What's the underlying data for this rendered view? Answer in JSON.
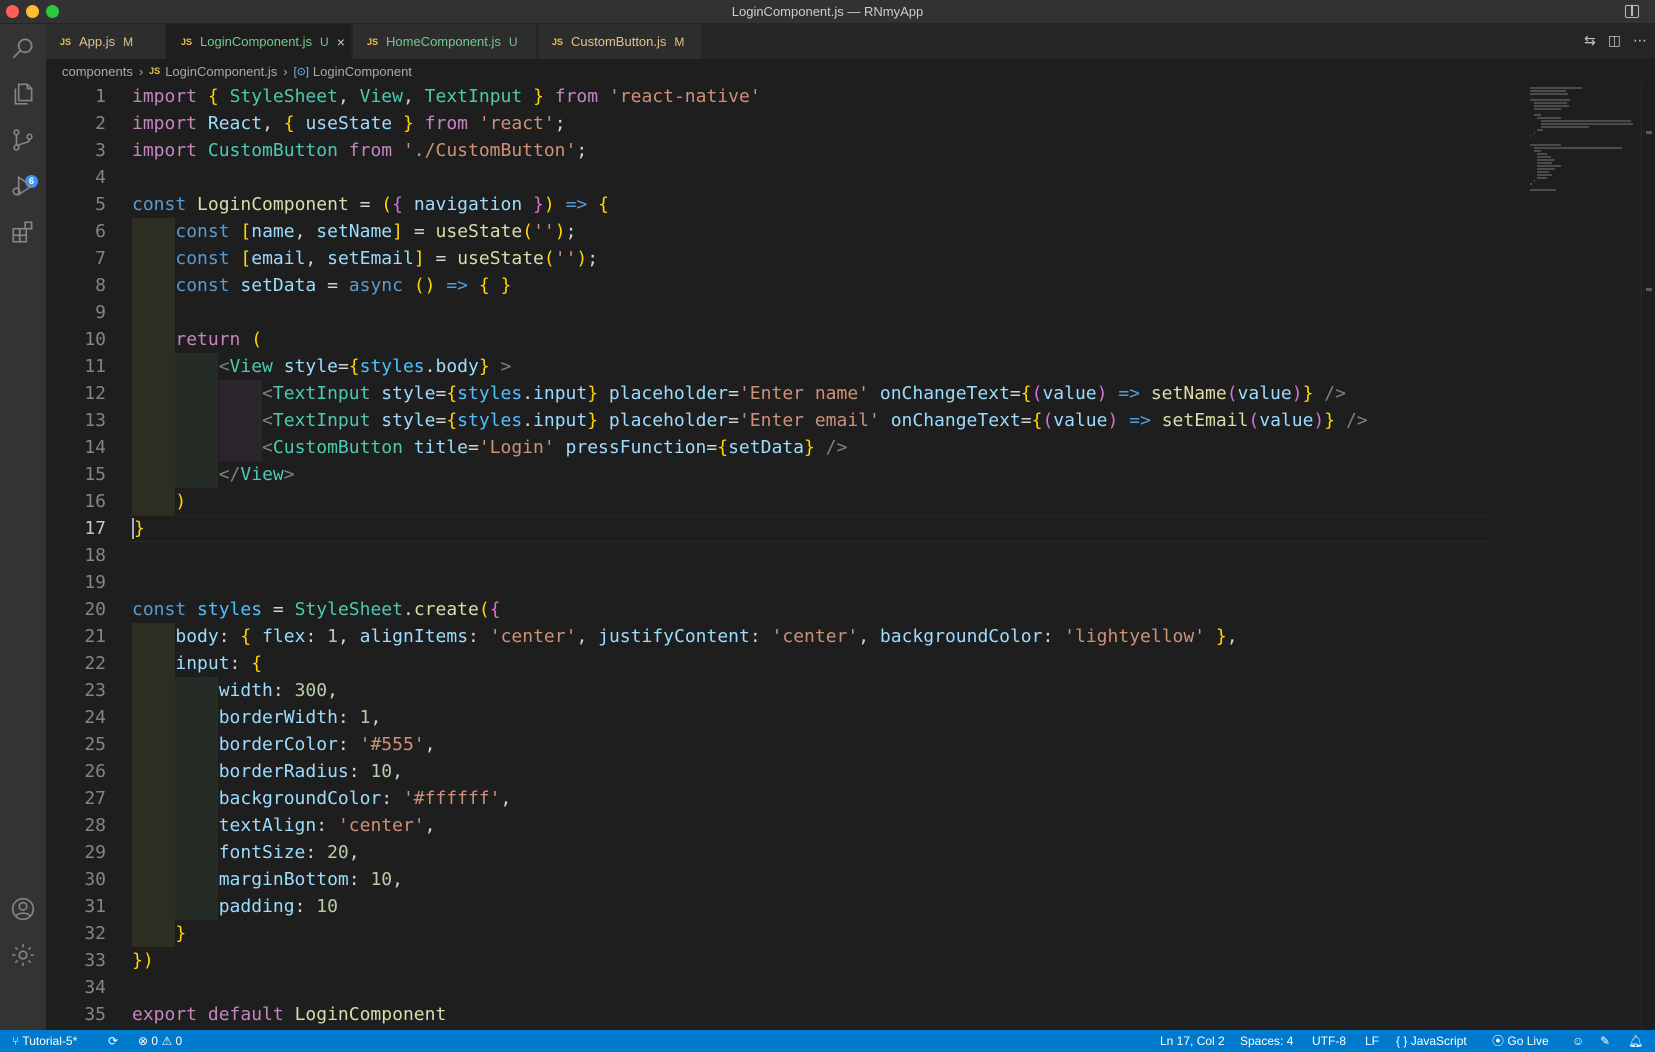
{
  "window": {
    "title": "LoginComponent.js — RNmyApp"
  },
  "activity_bar": {
    "items": [
      "search-icon",
      "explorer-icon",
      "source-control-icon",
      "run-debug-icon",
      "extensions-icon"
    ],
    "source_control_badge": "6",
    "bottom_items": [
      "accounts-icon",
      "manage-icon"
    ]
  },
  "tabs": [
    {
      "icon": "JS",
      "label": "App.js",
      "status": "M",
      "active": false
    },
    {
      "icon": "JS",
      "label": "LoginComponent.js",
      "status": "U",
      "active": true,
      "close": "×"
    },
    {
      "icon": "JS",
      "label": "HomeComponent.js",
      "status": "U",
      "active": false
    },
    {
      "icon": "JS",
      "label": "CustomButton.js",
      "status": "M",
      "active": false
    }
  ],
  "breadcrumb": {
    "folder": "components",
    "file_icon": "JS",
    "file": "LoginComponent.js",
    "symbol": "LoginComponent"
  },
  "editor": {
    "current_line": 17,
    "line_numbers": [
      "1",
      "2",
      "3",
      "4",
      "5",
      "6",
      "7",
      "8",
      "9",
      "10",
      "11",
      "12",
      "13",
      "14",
      "15",
      "16",
      "17",
      "18",
      "19",
      "20",
      "21",
      "22",
      "23",
      "24",
      "25",
      "26",
      "27",
      "28",
      "29",
      "30",
      "31",
      "32",
      "33",
      "34",
      "35"
    ],
    "lines": [
      "import { StyleSheet, View, TextInput } from 'react-native'",
      "import React, { useState } from 'react';",
      "import CustomButton from './CustomButton';",
      "",
      "const LoginComponent = ({ navigation }) => {",
      "    const [name, setName] = useState('');",
      "    const [email, setEmail] = useState('');",
      "    const setData = async () => { }",
      "",
      "    return (",
      "        <View style={styles.body} >",
      "            <TextInput style={styles.input} placeholder='Enter name' onChangeText={(value) => setName(value)} />",
      "            <TextInput style={styles.input} placeholder='Enter email' onChangeText={(value) => setEmail(value)} />",
      "            <CustomButton title='Login' pressFunction={setData} />",
      "        </View>",
      "    )",
      "}",
      "",
      "",
      "const styles = StyleSheet.create({",
      "    body: { flex: 1, alignItems: 'center', justifyContent: 'center', backgroundColor: 'lightyellow' },",
      "    input: {",
      "        width: 300,",
      "        borderWidth: 1,",
      "        borderColor: '#555',",
      "        borderRadius: 10,",
      "        backgroundColor: '#ffffff',",
      "        textAlign: 'center',",
      "        fontSize: 20,",
      "        marginBottom: 10,",
      "        padding: 10",
      "    }",
      "})",
      "",
      "export default LoginComponent"
    ]
  },
  "status_bar": {
    "branch": "Tutorial-5*",
    "errors": "0",
    "warnings": "0",
    "position": "Ln 17, Col 2",
    "spaces": "Spaces: 4",
    "encoding": "UTF-8",
    "eol": "LF",
    "language_icon": "{ }",
    "language": "JavaScript",
    "go_live": "Go Live"
  },
  "colors": {
    "status_bar": "#007acc",
    "editor_bg": "#1e1e1e",
    "activity_bar": "#333333",
    "keyword": "#c586c0",
    "storage": "#569cd6",
    "function": "#dcdcaa",
    "variable": "#9cdcfe",
    "type": "#4ec9b0",
    "string": "#ce9178",
    "number": "#b5cea8"
  }
}
